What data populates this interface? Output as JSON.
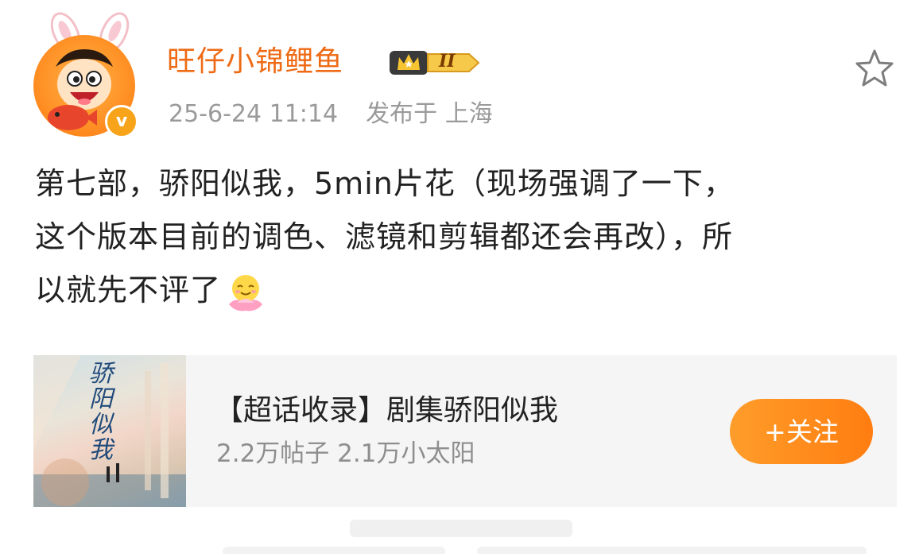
{
  "post": {
    "author": {
      "name": "旺仔小锦鲤鱼",
      "verified": true,
      "level_badge": "II"
    },
    "meta": {
      "timestamp": "25-6-24 11:14",
      "location": "发布于 上海"
    },
    "content_line1": "第七部，骄阳似我，5min片花（现场强调了一下，",
    "content_line2": "这个版本目前的调色、滤镜和剪辑都还会再改），所",
    "content_line3": "以就先不评了",
    "emoji_icon": "smiling-lotus-emoji",
    "favorite_icon": "star-outline-icon"
  },
  "topic_card": {
    "thumbnail_text": "骄阳似我",
    "title": "【超话收录】剧集骄阳似我",
    "stats": "2.2万帖子  2.1万小太阳",
    "follow_label": "+关注"
  },
  "colors": {
    "username": "#ee6a14",
    "follow_button": "#ff8c1a",
    "meta_text": "#9a9a9a",
    "card_bg": "#f5f5f5"
  }
}
